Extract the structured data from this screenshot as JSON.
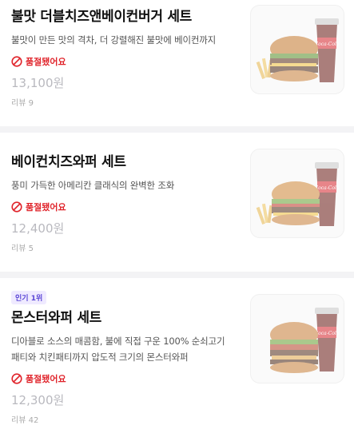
{
  "menu": [
    {
      "title": "불맛 더블치즈앤베이컨버거 세트",
      "description": [
        "불맛이 만든 맛의 격차, 더 강렬해진 불맛에 베이컨까지"
      ],
      "status": "품절됐어요",
      "price": "13,100원",
      "reviews": "리뷰 9"
    },
    {
      "title": "베이컨치즈와퍼 세트",
      "description": [
        "풍미 가득한 아메리칸 클래식의 완벽한 조화"
      ],
      "status": "품절됐어요",
      "price": "12,400원",
      "reviews": "리뷰 5"
    },
    {
      "badge": "인기 1위",
      "title": "몬스터와퍼 세트",
      "description": [
        "디아블로 소스의 매콤함, 불에 직접 구운 100% 순쇠고기",
        "패티와 치킨패티까지 압도적 크기의 몬스터와퍼"
      ],
      "status": "품절됐어요",
      "price": "12,300원",
      "reviews": "리뷰 42"
    }
  ],
  "cup_logo": "Coca-Cola",
  "colors": {
    "soldout": "#e0242b",
    "badge_text": "#5b46d6",
    "badge_bg": "#efeaff",
    "price": "#b9b9bf"
  }
}
